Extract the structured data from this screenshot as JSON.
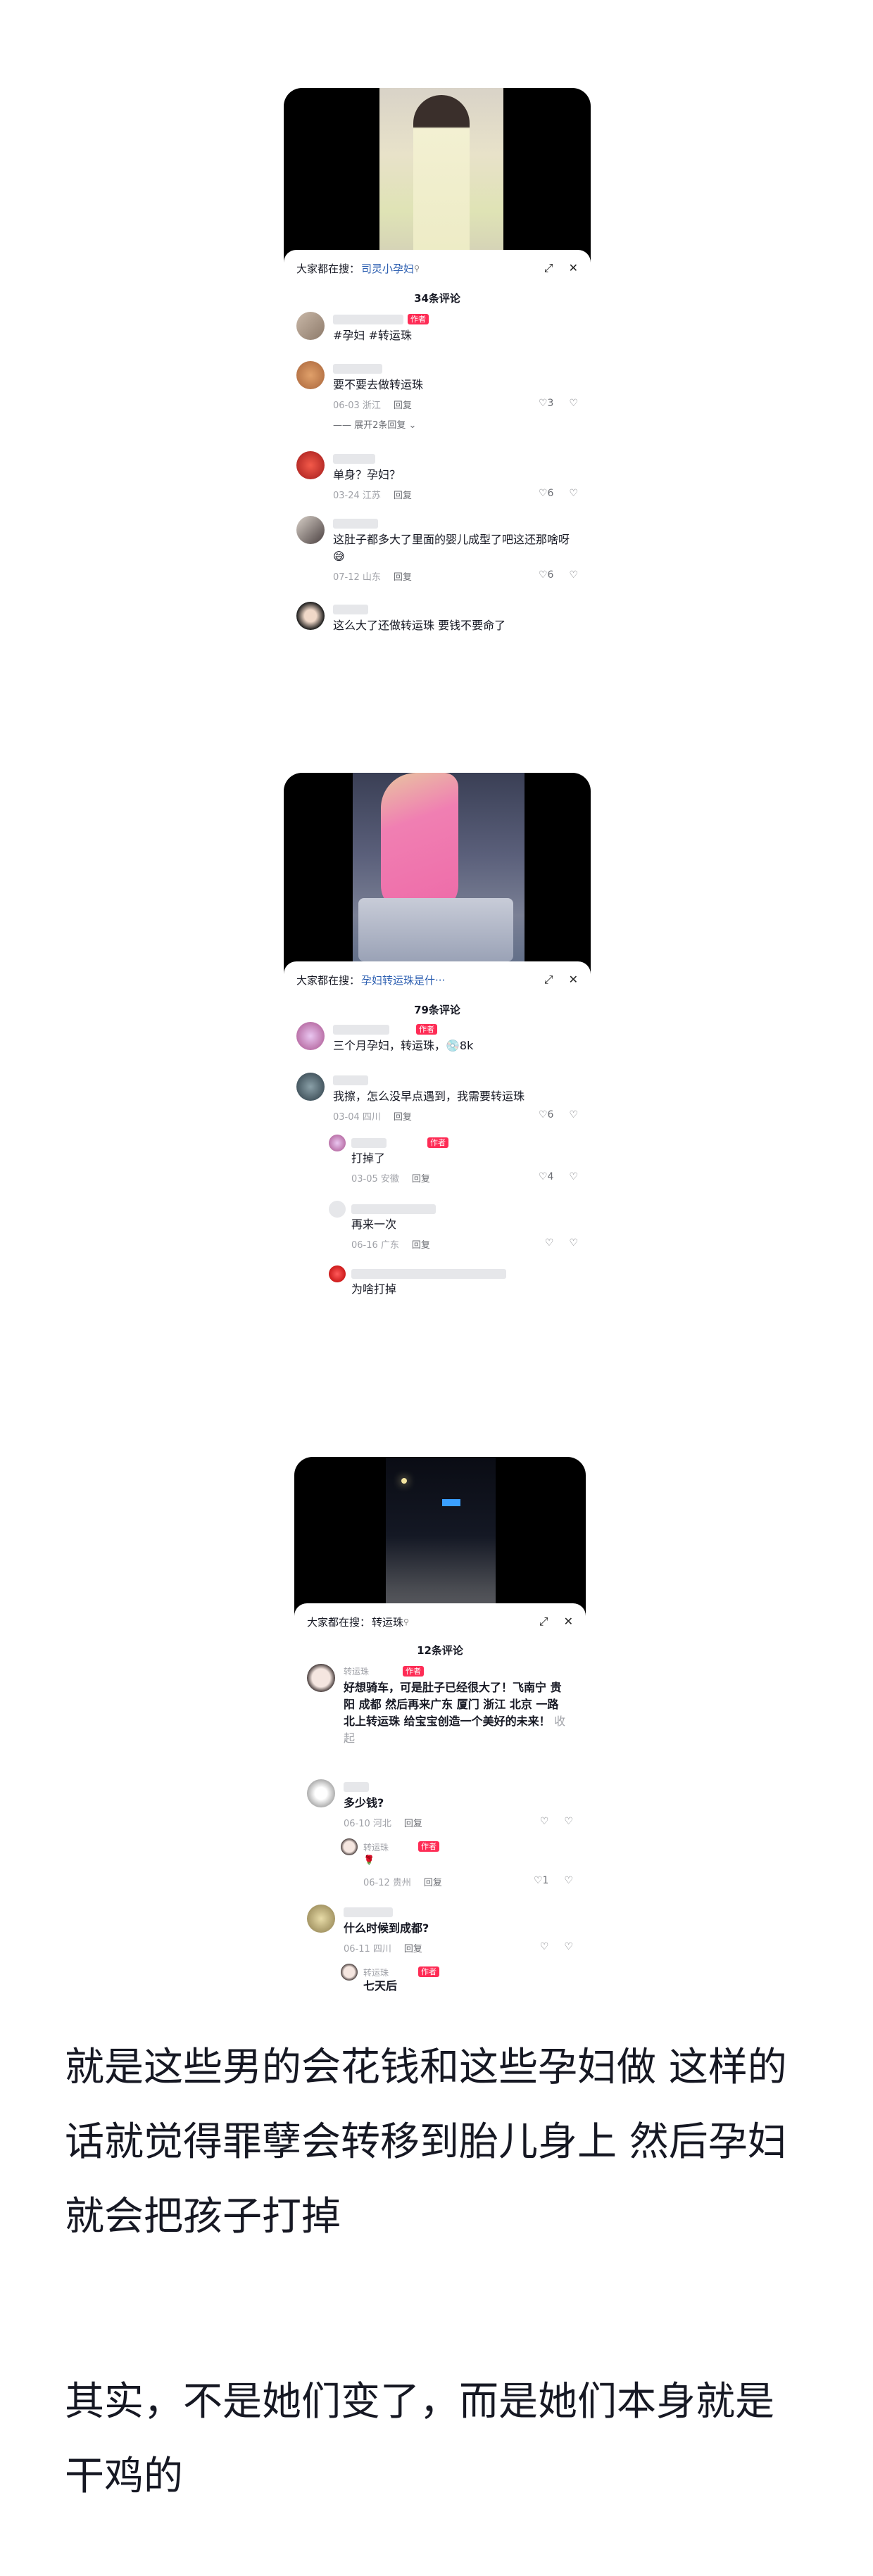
{
  "screenshots": [
    {
      "search_label": "大家都在搜：",
      "search_query": "司灵小孕妇",
      "comment_count": "34条评论",
      "comments": [
        {
          "tag": "作者",
          "text": "#孕妇 #转运珠",
          "meta": "",
          "likes": ""
        },
        {
          "tag": "",
          "text": "要不要去做转运珠",
          "meta": "06-03 浙江",
          "likes": "3",
          "expand": "展开2条回复"
        },
        {
          "tag": "",
          "text": "单身？孕妇？",
          "meta": "03-24 江苏",
          "likes": "6"
        },
        {
          "tag": "",
          "text": "这肚子都多大了里面的婴儿成型了吧这还那啥呀😅",
          "meta": "07-12 山东",
          "likes": "6"
        },
        {
          "tag": "",
          "text": "这么大了还做转运珠 要钱不要命了",
          "meta": "",
          "likes": ""
        }
      ]
    },
    {
      "search_label": "大家都在搜：",
      "search_query": "孕妇转运珠是什···",
      "comment_count": "79条评论",
      "comments": [
        {
          "tag": "作者",
          "text": "三个月孕妇，转运珠，💿8k",
          "meta": "",
          "likes": ""
        },
        {
          "tag": "",
          "text": "我擦，怎么没早点遇到，我需要转运珠",
          "meta": "03-04 四川",
          "likes": "6"
        },
        {
          "tag": "作者",
          "text": "打掉了",
          "meta": "03-05 安徽",
          "likes": "4"
        },
        {
          "tag": "",
          "text": "再来一次",
          "meta": "06-16 广东",
          "likes": ""
        },
        {
          "tag": "",
          "text": "为啥打掉",
          "meta": "",
          "likes": ""
        }
      ]
    },
    {
      "search_label": "大家都在搜：",
      "search_query": "转运珠",
      "comment_count": "12条评论",
      "comments": [
        {
          "tag": "作者",
          "name": "转运珠",
          "text": "好想骑车，可是肚子已经很大了！飞南宁 贵阳 成都 然后再来广东 厦门 浙江 北京 一路北上转运珠 给宝宝创造一个美好的未来！",
          "collapse": "收起"
        },
        {
          "tag": "",
          "text": "多少钱?",
          "meta": "06-10 河北",
          "likes": ""
        },
        {
          "tag": "作者",
          "name": "转运珠",
          "text": "🌹",
          "meta": "06-12 贵州",
          "likes": "1"
        },
        {
          "tag": "",
          "text": "什么时候到成都?",
          "meta": "06-11 四川",
          "likes": ""
        },
        {
          "tag": "作者",
          "name": "转运珠",
          "text": "七天后",
          "meta": "",
          "likes": ""
        }
      ]
    }
  ],
  "reply_label": "回复",
  "article": {
    "paragraph1": "就是这些男的会花钱和这些孕妇做 这样的话就觉得罪孽会转移到胎儿身上 然后孕妇就会把孩子打掉",
    "paragraph2": "其实，不是她们变了，而是她们本身就是干鸡的"
  }
}
